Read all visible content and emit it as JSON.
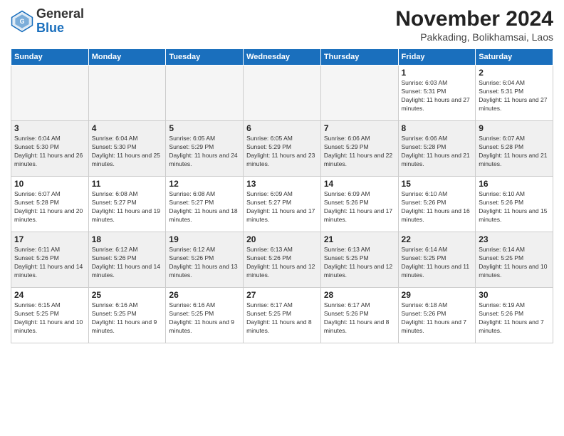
{
  "logo": {
    "general": "General",
    "blue": "Blue"
  },
  "title": "November 2024",
  "location": "Pakkading, Bolikhamsai, Laos",
  "days_of_week": [
    "Sunday",
    "Monday",
    "Tuesday",
    "Wednesday",
    "Thursday",
    "Friday",
    "Saturday"
  ],
  "weeks": [
    [
      {
        "day": "",
        "info": ""
      },
      {
        "day": "",
        "info": ""
      },
      {
        "day": "",
        "info": ""
      },
      {
        "day": "",
        "info": ""
      },
      {
        "day": "",
        "info": ""
      },
      {
        "day": "1",
        "info": "Sunrise: 6:03 AM\nSunset: 5:31 PM\nDaylight: 11 hours and 27 minutes."
      },
      {
        "day": "2",
        "info": "Sunrise: 6:04 AM\nSunset: 5:31 PM\nDaylight: 11 hours and 27 minutes."
      }
    ],
    [
      {
        "day": "3",
        "info": "Sunrise: 6:04 AM\nSunset: 5:30 PM\nDaylight: 11 hours and 26 minutes."
      },
      {
        "day": "4",
        "info": "Sunrise: 6:04 AM\nSunset: 5:30 PM\nDaylight: 11 hours and 25 minutes."
      },
      {
        "day": "5",
        "info": "Sunrise: 6:05 AM\nSunset: 5:29 PM\nDaylight: 11 hours and 24 minutes."
      },
      {
        "day": "6",
        "info": "Sunrise: 6:05 AM\nSunset: 5:29 PM\nDaylight: 11 hours and 23 minutes."
      },
      {
        "day": "7",
        "info": "Sunrise: 6:06 AM\nSunset: 5:29 PM\nDaylight: 11 hours and 22 minutes."
      },
      {
        "day": "8",
        "info": "Sunrise: 6:06 AM\nSunset: 5:28 PM\nDaylight: 11 hours and 21 minutes."
      },
      {
        "day": "9",
        "info": "Sunrise: 6:07 AM\nSunset: 5:28 PM\nDaylight: 11 hours and 21 minutes."
      }
    ],
    [
      {
        "day": "10",
        "info": "Sunrise: 6:07 AM\nSunset: 5:28 PM\nDaylight: 11 hours and 20 minutes."
      },
      {
        "day": "11",
        "info": "Sunrise: 6:08 AM\nSunset: 5:27 PM\nDaylight: 11 hours and 19 minutes."
      },
      {
        "day": "12",
        "info": "Sunrise: 6:08 AM\nSunset: 5:27 PM\nDaylight: 11 hours and 18 minutes."
      },
      {
        "day": "13",
        "info": "Sunrise: 6:09 AM\nSunset: 5:27 PM\nDaylight: 11 hours and 17 minutes."
      },
      {
        "day": "14",
        "info": "Sunrise: 6:09 AM\nSunset: 5:26 PM\nDaylight: 11 hours and 17 minutes."
      },
      {
        "day": "15",
        "info": "Sunrise: 6:10 AM\nSunset: 5:26 PM\nDaylight: 11 hours and 16 minutes."
      },
      {
        "day": "16",
        "info": "Sunrise: 6:10 AM\nSunset: 5:26 PM\nDaylight: 11 hours and 15 minutes."
      }
    ],
    [
      {
        "day": "17",
        "info": "Sunrise: 6:11 AM\nSunset: 5:26 PM\nDaylight: 11 hours and 14 minutes."
      },
      {
        "day": "18",
        "info": "Sunrise: 6:12 AM\nSunset: 5:26 PM\nDaylight: 11 hours and 14 minutes."
      },
      {
        "day": "19",
        "info": "Sunrise: 6:12 AM\nSunset: 5:26 PM\nDaylight: 11 hours and 13 minutes."
      },
      {
        "day": "20",
        "info": "Sunrise: 6:13 AM\nSunset: 5:26 PM\nDaylight: 11 hours and 12 minutes."
      },
      {
        "day": "21",
        "info": "Sunrise: 6:13 AM\nSunset: 5:25 PM\nDaylight: 11 hours and 12 minutes."
      },
      {
        "day": "22",
        "info": "Sunrise: 6:14 AM\nSunset: 5:25 PM\nDaylight: 11 hours and 11 minutes."
      },
      {
        "day": "23",
        "info": "Sunrise: 6:14 AM\nSunset: 5:25 PM\nDaylight: 11 hours and 10 minutes."
      }
    ],
    [
      {
        "day": "24",
        "info": "Sunrise: 6:15 AM\nSunset: 5:25 PM\nDaylight: 11 hours and 10 minutes."
      },
      {
        "day": "25",
        "info": "Sunrise: 6:16 AM\nSunset: 5:25 PM\nDaylight: 11 hours and 9 minutes."
      },
      {
        "day": "26",
        "info": "Sunrise: 6:16 AM\nSunset: 5:25 PM\nDaylight: 11 hours and 9 minutes."
      },
      {
        "day": "27",
        "info": "Sunrise: 6:17 AM\nSunset: 5:25 PM\nDaylight: 11 hours and 8 minutes."
      },
      {
        "day": "28",
        "info": "Sunrise: 6:17 AM\nSunset: 5:26 PM\nDaylight: 11 hours and 8 minutes."
      },
      {
        "day": "29",
        "info": "Sunrise: 6:18 AM\nSunset: 5:26 PM\nDaylight: 11 hours and 7 minutes."
      },
      {
        "day": "30",
        "info": "Sunrise: 6:19 AM\nSunset: 5:26 PM\nDaylight: 11 hours and 7 minutes."
      }
    ]
  ]
}
